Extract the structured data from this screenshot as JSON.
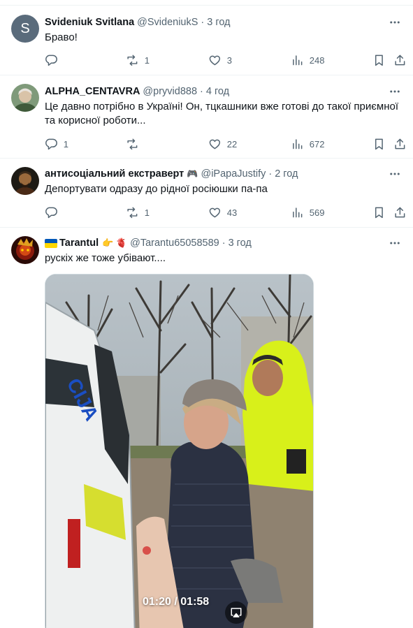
{
  "tweets": [
    {
      "name": "Svideniuk Svitlana",
      "handle": "@SvideniukS",
      "time": "3 год",
      "avatar_letter": "S",
      "avatar_color": "#5a6b7b",
      "text": "Браво!",
      "stats": {
        "replies": "",
        "reposts": "1",
        "likes": "3",
        "views": "248"
      }
    },
    {
      "name": "ALPHA_CENTAVRA",
      "handle": "@pryvid888",
      "time": "4 год",
      "text_line1": "Це давно потрібно в Україні! Он, тцкашники вже готові до такої приємної",
      "text_line2": "та корисної роботи...",
      "stats": {
        "replies": "1",
        "reposts": "",
        "likes": "22",
        "views": "672"
      }
    },
    {
      "name": "антисоціальний екстраверт",
      "name_emoji": "🎮",
      "handle": "@iPapaJustify",
      "time": "2 год",
      "text": "Депортувати одразу до рідної росіюшки па-па",
      "stats": {
        "replies": "",
        "reposts": "1",
        "likes": "43",
        "views": "569"
      }
    },
    {
      "name": "Tarantul",
      "name_suffix": "👉 🫀",
      "handle": "@Tarantu65058589",
      "time": "3 год",
      "text": "рускіх же тоже убівают....",
      "video": {
        "elapsed": "01:20",
        "duration": "01:58",
        "van_text": "CIJA"
      }
    }
  ],
  "separator": "·",
  "colors": {
    "text_primary": "#0f1419",
    "text_secondary": "#536471",
    "border": "#eff3f4",
    "flag_blue": "#0057b7",
    "flag_yellow": "#ffd700",
    "vest_yellow": "#d8f01a"
  }
}
